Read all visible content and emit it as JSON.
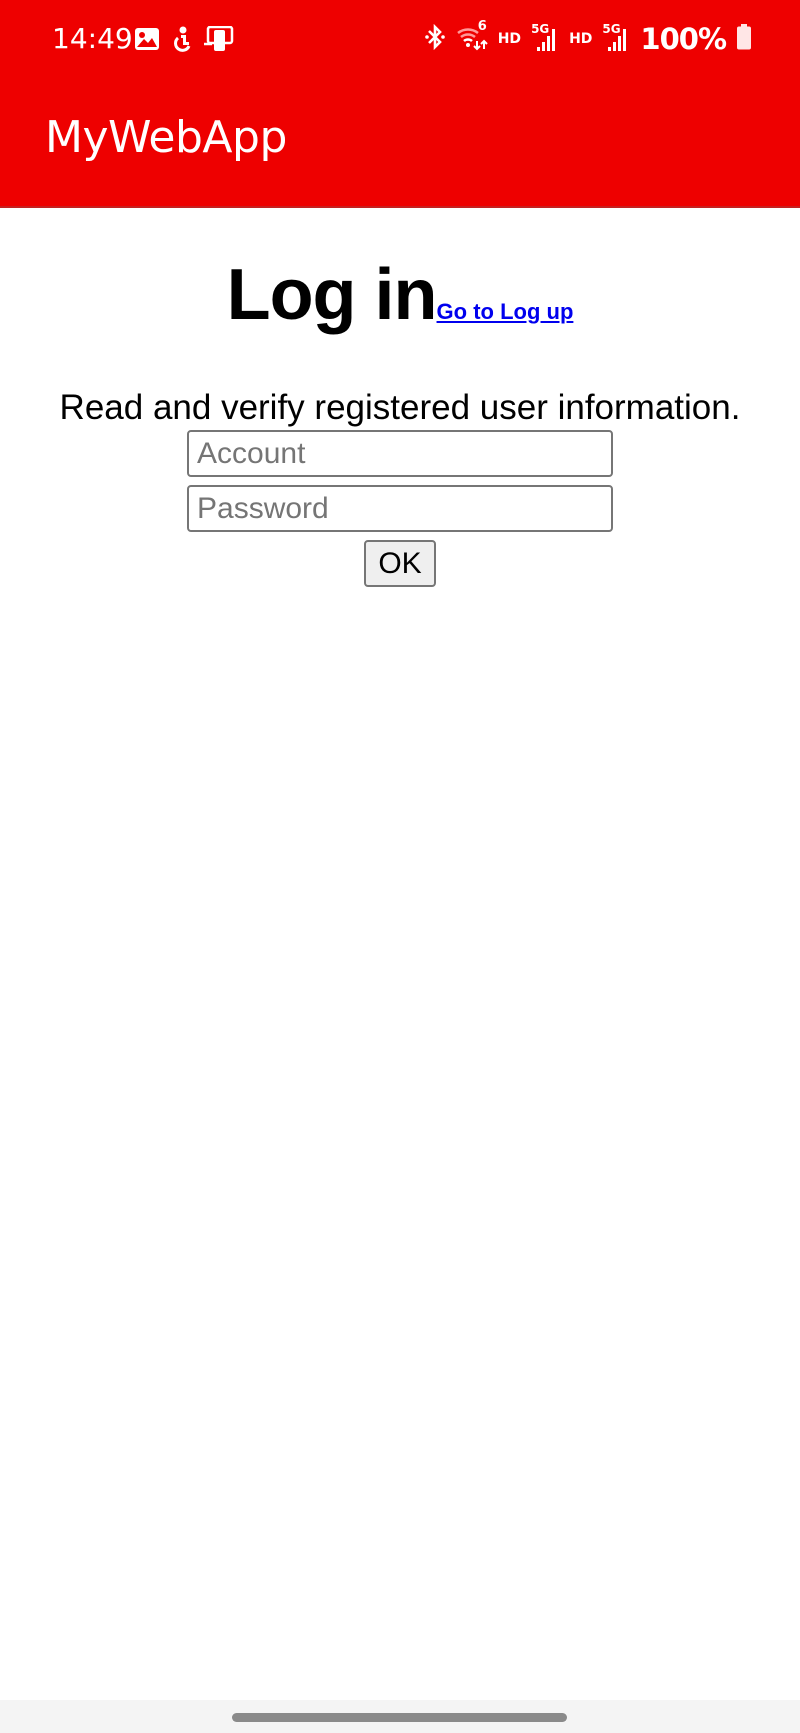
{
  "status_bar": {
    "time": "14:49",
    "left_icons": [
      "gallery-icon",
      "accessibility-icon",
      "screen-mirror-icon"
    ],
    "right_icons": [
      "bluetooth-icon",
      "wifi-6-icon",
      "hd-voice-icon",
      "5g-signal-icon",
      "hd-voice-icon",
      "5g-signal-icon",
      "battery-icon"
    ],
    "hd_label": "HD",
    "fiveg_label": "5G",
    "wifi_label": "6",
    "battery_percent": "100%"
  },
  "app_bar": {
    "title": "MyWebApp",
    "color": "#ee0000"
  },
  "page": {
    "heading": "Log in",
    "signup_link": "Go to Log up",
    "description": "Read and verify registered user information.",
    "account_field": {
      "placeholder": "Account",
      "value": ""
    },
    "password_field": {
      "placeholder": "Password",
      "value": ""
    },
    "ok_button": "OK"
  }
}
